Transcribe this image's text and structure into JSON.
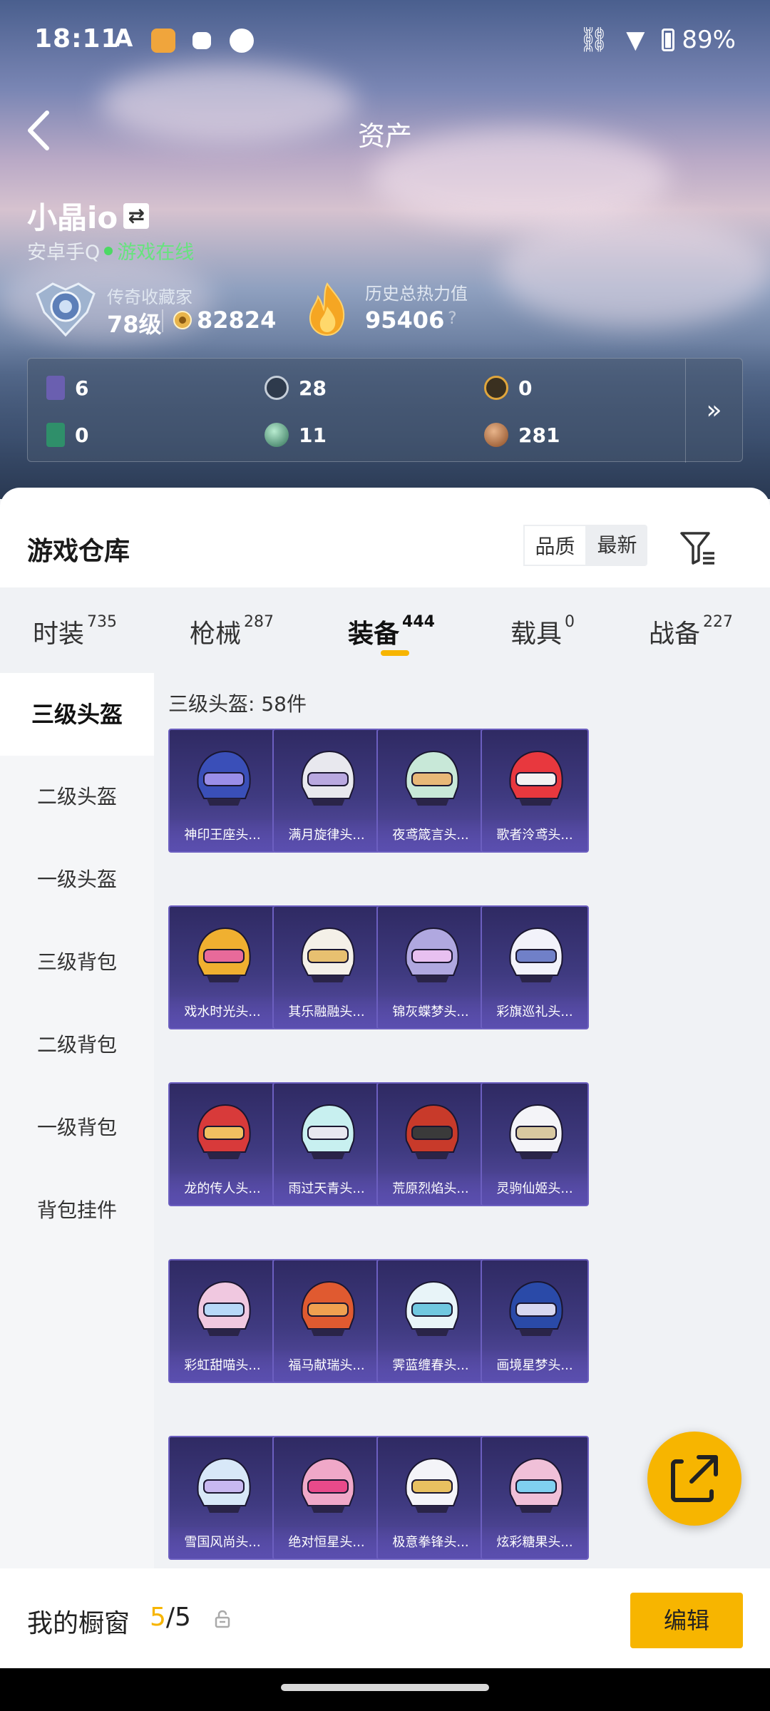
{
  "status_bar": {
    "time": "18:11",
    "battery": "89%"
  },
  "header": {
    "title": "资产"
  },
  "profile": {
    "username": "小晶io",
    "platform": "安卓手Q",
    "status": "游戏在线",
    "rank_label": "传奇收藏家",
    "level": "78级",
    "coins": "82824",
    "heat_label": "历史总热力值",
    "heat_value": "95406",
    "help": "?"
  },
  "stats": [
    {
      "icon": "purple-card-icon",
      "value": "6"
    },
    {
      "icon": "silver-medal-icon",
      "value": "28"
    },
    {
      "icon": "gold-medal-icon",
      "value": "0"
    },
    {
      "icon": "green-card-icon",
      "value": "0"
    },
    {
      "icon": "jade-orb-icon",
      "value": "11"
    },
    {
      "icon": "bronze-coin-icon",
      "value": "281"
    }
  ],
  "warehouse": {
    "title": "游戏仓库",
    "sort_options": [
      "品质",
      "最新"
    ],
    "tabs": [
      {
        "label": "时装",
        "count": "735"
      },
      {
        "label": "枪械",
        "count": "287"
      },
      {
        "label": "装备",
        "count": "444"
      },
      {
        "label": "载具",
        "count": "0"
      },
      {
        "label": "战备",
        "count": "227"
      }
    ],
    "categories": [
      "三级头盔",
      "二级头盔",
      "一级头盔",
      "三级背包",
      "二级背包",
      "一级背包",
      "背包挂件"
    ],
    "section_title": "三级头盔: 58件",
    "items": [
      "神印王座头...",
      "满月旋律头...",
      "夜鸢箴言头...",
      "歌者泠鸢头...",
      "戏水时光头...",
      "其乐融融头...",
      "锦灰蝶梦头...",
      "彩旗巡礼头...",
      "龙的传人头...",
      "雨过天青头...",
      "荒原烈焰头...",
      "灵驹仙姬头...",
      "彩虹甜喵头...",
      "福马献瑞头...",
      "霁蓝缠春头...",
      "画境星梦头...",
      "雪国风尚头...",
      "绝对恒星头...",
      "极意拳锋头...",
      "炫彩糖果头..."
    ]
  },
  "showcase": {
    "label": "我的橱窗",
    "current": "5",
    "sep_total": "/5",
    "edit": "编辑"
  },
  "colors": {
    "accent": "#f7b500",
    "online": "#67e37e",
    "card": "#3f3a80"
  }
}
